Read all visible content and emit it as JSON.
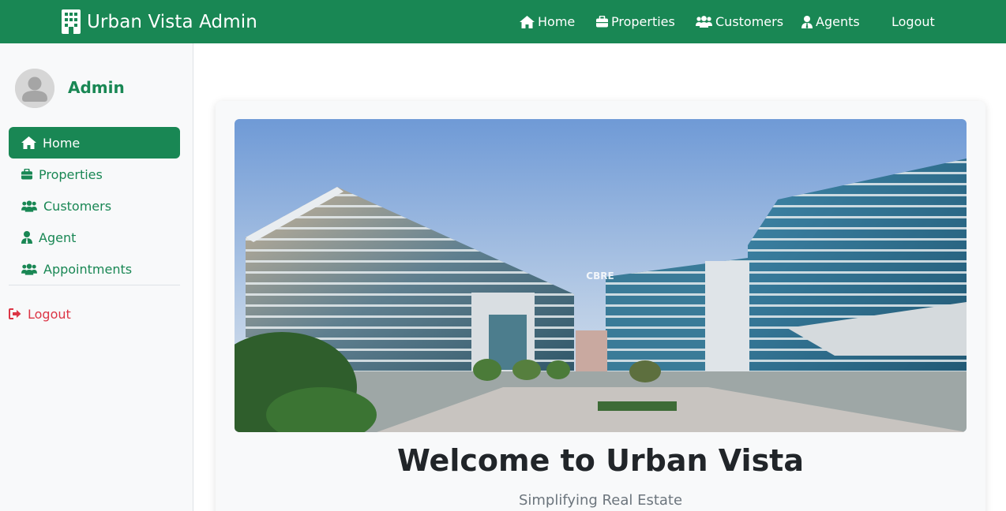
{
  "app": {
    "title": "Urban Vista Admin",
    "brand_color": "#198754",
    "danger_color": "#dc3545"
  },
  "topnav": {
    "items": [
      {
        "label": "Home",
        "icon": "home-icon"
      },
      {
        "label": "Properties",
        "icon": "briefcase-icon"
      },
      {
        "label": "Customers",
        "icon": "users-icon"
      },
      {
        "label": "Agents",
        "icon": "user-tie-icon"
      }
    ],
    "logout_label": "Logout"
  },
  "sidebar": {
    "user_name": "Admin",
    "items": [
      {
        "label": "Home",
        "icon": "home-icon",
        "active": true
      },
      {
        "label": "Properties",
        "icon": "briefcase-icon",
        "active": false
      },
      {
        "label": "Customers",
        "icon": "users-icon",
        "active": false
      },
      {
        "label": "Agent",
        "icon": "user-tie-icon",
        "active": false
      },
      {
        "label": "Appointments",
        "icon": "users-icon",
        "active": false
      }
    ],
    "logout_label": "Logout"
  },
  "main": {
    "hero_watermark": "CBRE",
    "welcome_title": "Welcome to Urban Vista",
    "tagline": "Simplifying Real Estate"
  }
}
